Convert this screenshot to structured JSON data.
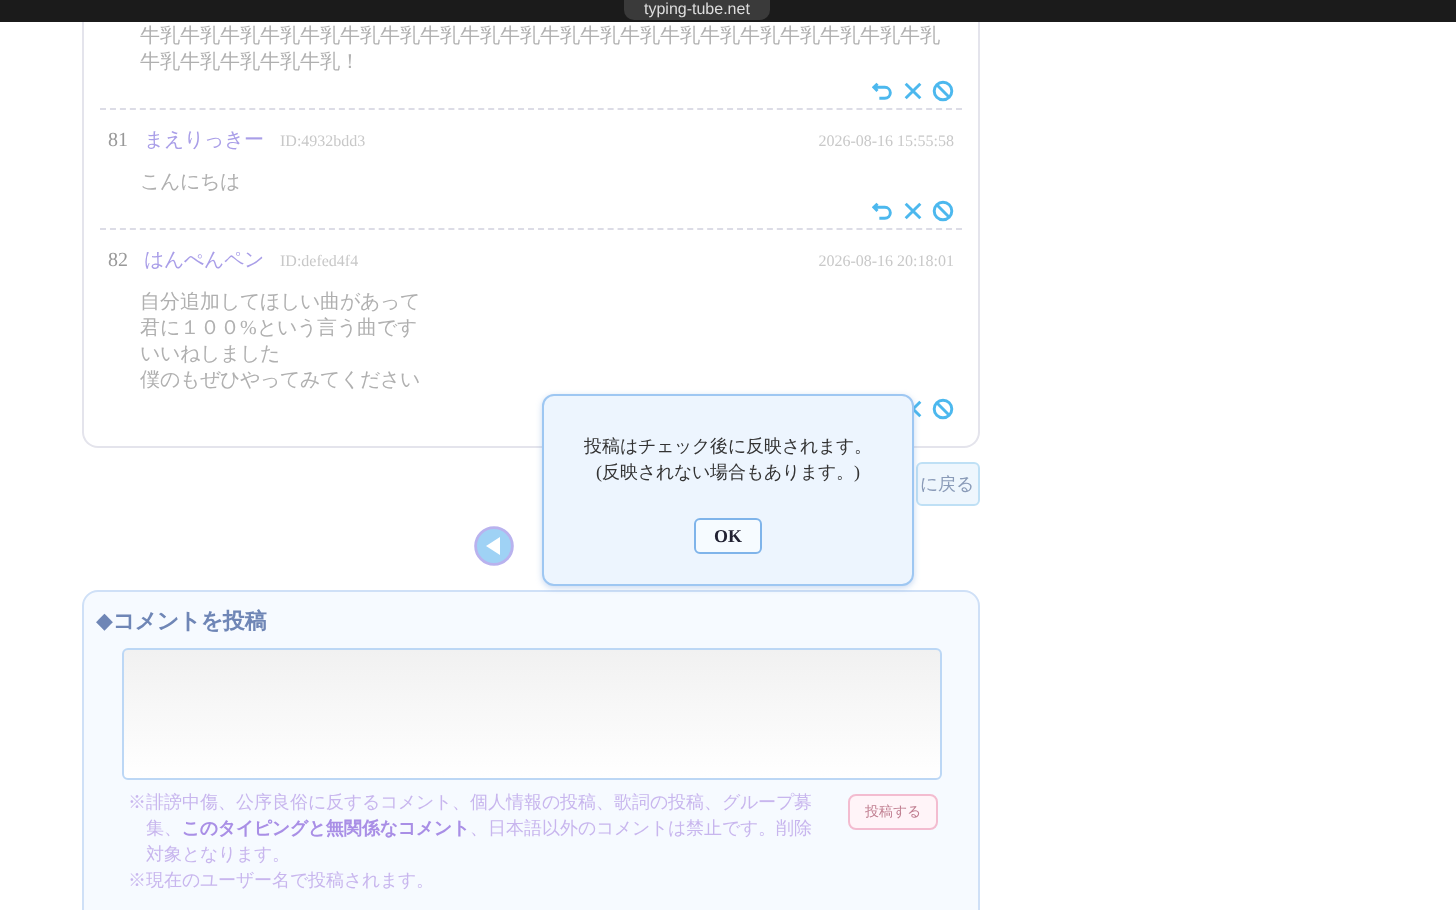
{
  "browser_bar": {
    "url": "typing-tube.net"
  },
  "partial_comment": {
    "body": "牛乳牛乳牛乳牛乳牛乳牛乳牛乳牛乳牛乳牛乳牛乳牛乳牛乳牛乳牛乳牛乳牛乳牛乳牛乳牛乳牛乳牛乳牛乳牛乳牛乳！"
  },
  "comments": [
    {
      "number": "81",
      "name": "まえりっきー",
      "id": "ID:4932bdd3",
      "date": "2026-08-16 15:55:58",
      "lines": [
        "こんにちは"
      ]
    },
    {
      "number": "82",
      "name": "はんぺんペン",
      "id": "ID:defed4f4",
      "date": "2026-08-16 20:18:01",
      "lines": [
        "自分追加してほしい曲があって",
        "君に１００%という言う曲です",
        "いいねしました",
        "僕のもぜひやってみてください"
      ]
    }
  ],
  "back_button": {
    "label": "に戻る"
  },
  "dialog": {
    "message": [
      "投稿はチェック後に反映されます。",
      "(反映されない場合もあります。)"
    ],
    "ok": "OK"
  },
  "post_form": {
    "title": "◆コメントを投稿",
    "submit": "投稿する",
    "notes": [
      "※誹謗中傷、公序良俗に反するコメント、個人情報の投稿、歌詞の投稿、グループ募集、**このタイピングと無関係なコメント**、日本語以外のコメントは禁止です。削除対象となります。",
      "※現在のユーザー名で投稿されます。"
    ]
  }
}
